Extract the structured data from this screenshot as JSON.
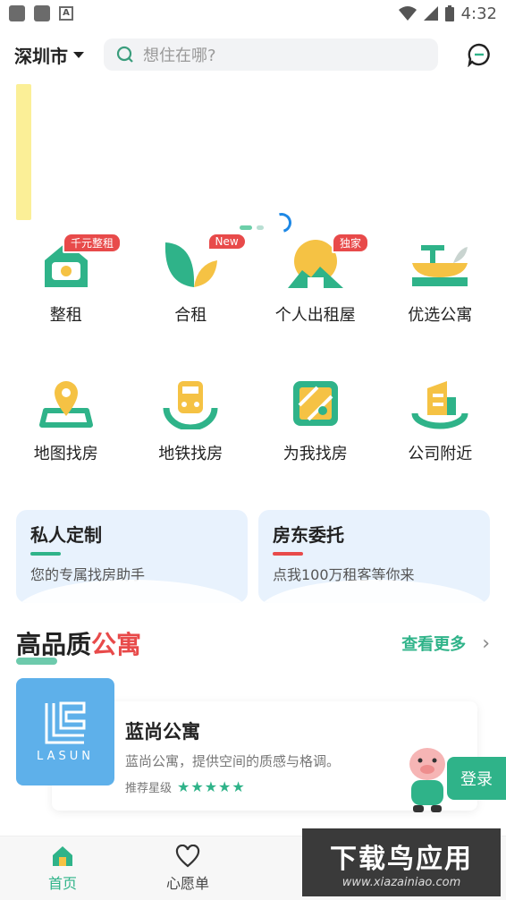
{
  "status": {
    "time": "4:32"
  },
  "header": {
    "city": "深圳市",
    "search_placeholder": "想住在哪?"
  },
  "grid": [
    {
      "label": "整租",
      "badge": "千元整租",
      "icon": "house-icon"
    },
    {
      "label": "合租",
      "badge": "New",
      "icon": "leaves-icon"
    },
    {
      "label": "个人出租屋",
      "badge": "独家",
      "icon": "sun-house-icon"
    },
    {
      "label": "优选公寓",
      "badge": "",
      "icon": "bowl-icon"
    },
    {
      "label": "地图找房",
      "badge": "",
      "icon": "map-pin-icon"
    },
    {
      "label": "地铁找房",
      "badge": "",
      "icon": "subway-icon"
    },
    {
      "label": "为我找房",
      "badge": "",
      "icon": "map-icon"
    },
    {
      "label": "公司附近",
      "badge": "",
      "icon": "building-icon"
    }
  ],
  "cards": [
    {
      "title": "私人定制",
      "subtitle": "您的专属找房助手",
      "accent": "#2fb389"
    },
    {
      "title": "房东委托",
      "subtitle": "点我100万租客等你来",
      "accent": "#e84a4a"
    }
  ],
  "section": {
    "title_a": "高品质",
    "title_b": "公寓",
    "more": "查看更多"
  },
  "apartment": {
    "logo_text": "LASUN",
    "name": "蓝尚公寓",
    "desc": "蓝尚公寓，提供空间的质感与格调。",
    "rating_label": "推荐星级",
    "stars": "★★★★★",
    "rating": 5
  },
  "login_label": "登录",
  "tabs": [
    {
      "label": "首页",
      "active": true
    },
    {
      "label": "心愿单",
      "active": false
    }
  ],
  "watermark": {
    "line1": "下载鸟应用",
    "line2": "www.xiazainiao.com"
  },
  "colors": {
    "brand": "#2fb389",
    "hot": "#e84a4a"
  }
}
